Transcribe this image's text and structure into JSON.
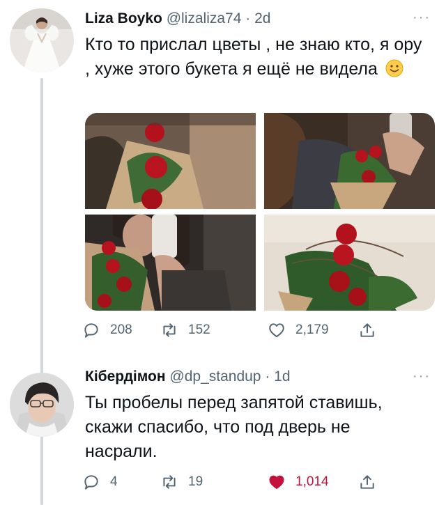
{
  "tweet1": {
    "name": "Liza Boyko",
    "handle": "@lizaliza74",
    "dot": "·",
    "time": "2d",
    "more": "···",
    "text": "Кто то прислал цветы , не знаю кто, я ору , хуже этого букета я ещё не видела",
    "emoji_icon": "slightly-smiling-face-icon",
    "media": [
      {
        "alt": "photo-bouquet-1"
      },
      {
        "alt": "photo-bouquet-2"
      },
      {
        "alt": "photo-bouquet-3"
      },
      {
        "alt": "photo-bouquet-4"
      }
    ],
    "actions": {
      "replies": "208",
      "retweets": "152",
      "likes": "2,179"
    },
    "liked": false
  },
  "tweet2": {
    "name": "Кібердімон",
    "handle": "@dp_standup",
    "dot": "·",
    "time": "1d",
    "more": "···",
    "text": "Ты пробелы перед запятой ставишь, скажи спасибо, что под дверь не насрали.",
    "actions": {
      "replies": "4",
      "retweets": "19",
      "likes": "1,014"
    },
    "liked": true
  },
  "colors": {
    "text": "#0f1419",
    "secondary": "#536471",
    "like_active": "#c3123c",
    "thread_line": "#cfd9de"
  }
}
